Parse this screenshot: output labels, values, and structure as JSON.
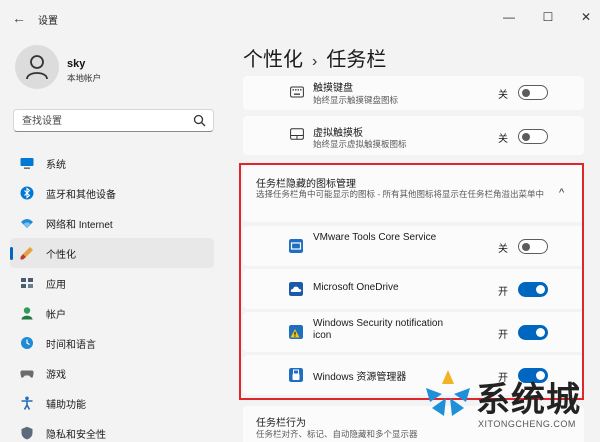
{
  "window": {
    "title": "设置",
    "back_glyph": "←",
    "minimize_glyph": "—",
    "maximize_glyph": "☐",
    "close_glyph": "✕"
  },
  "user": {
    "name": "sky",
    "account_type": "本地帐户"
  },
  "search": {
    "placeholder": "查找设置"
  },
  "sidebar": {
    "items": [
      {
        "label": "系统",
        "icon": "monitor-icon",
        "active": false
      },
      {
        "label": "蓝牙和其他设备",
        "icon": "bluetooth-icon",
        "active": false
      },
      {
        "label": "网络和 Internet",
        "icon": "wifi-icon",
        "active": false
      },
      {
        "label": "个性化",
        "icon": "brush-icon",
        "active": true
      },
      {
        "label": "应用",
        "icon": "apps-icon",
        "active": false
      },
      {
        "label": "帐户",
        "icon": "person-icon",
        "active": false
      },
      {
        "label": "时间和语言",
        "icon": "clock-globe-icon",
        "active": false
      },
      {
        "label": "游戏",
        "icon": "gamepad-icon",
        "active": false
      },
      {
        "label": "辅助功能",
        "icon": "accessibility-icon",
        "active": false
      },
      {
        "label": "隐私和安全性",
        "icon": "shield-icon",
        "active": false
      }
    ]
  },
  "breadcrumb": {
    "parent": "个性化",
    "separator": "›",
    "current": "任务栏"
  },
  "rows_top": [
    {
      "title": "触摸键盘",
      "desc": "始终显示触摸键盘图标",
      "state": "关",
      "on": false,
      "icon": "keyboard-icon"
    },
    {
      "title": "虚拟触摸板",
      "desc": "始终显示虚拟触摸板图标",
      "state": "关",
      "on": false,
      "icon": "touchpad-icon"
    }
  ],
  "hidden_icons": {
    "title": "任务栏隐藏的图标管理",
    "desc": "选择任务栏角中可能显示的图标 - 所有其他图标将显示在任务栏角溢出菜单中",
    "chevron": "^",
    "items": [
      {
        "name": "VMware Tools Core Service",
        "state": "关",
        "on": false,
        "icon": "vmware-icon"
      },
      {
        "name": "Microsoft OneDrive",
        "state": "开",
        "on": true,
        "icon": "onedrive-icon"
      },
      {
        "name": "Windows Security notification icon",
        "state": "开",
        "on": true,
        "icon": "security-warning-icon"
      },
      {
        "name": "Windows 资源管理器",
        "state": "开",
        "on": true,
        "icon": "usb-drive-icon"
      }
    ]
  },
  "taskbar_behavior": {
    "title": "任务栏行为",
    "desc": "任务栏对齐、标记、自动隐藏和多个显示器"
  },
  "watermark": {
    "title": "系统城",
    "subtitle": "XITONGCHENG.COM"
  },
  "colors": {
    "accent": "#0067c0",
    "highlight": "#e0262c",
    "watermark_blue": "#1e8fd8"
  }
}
